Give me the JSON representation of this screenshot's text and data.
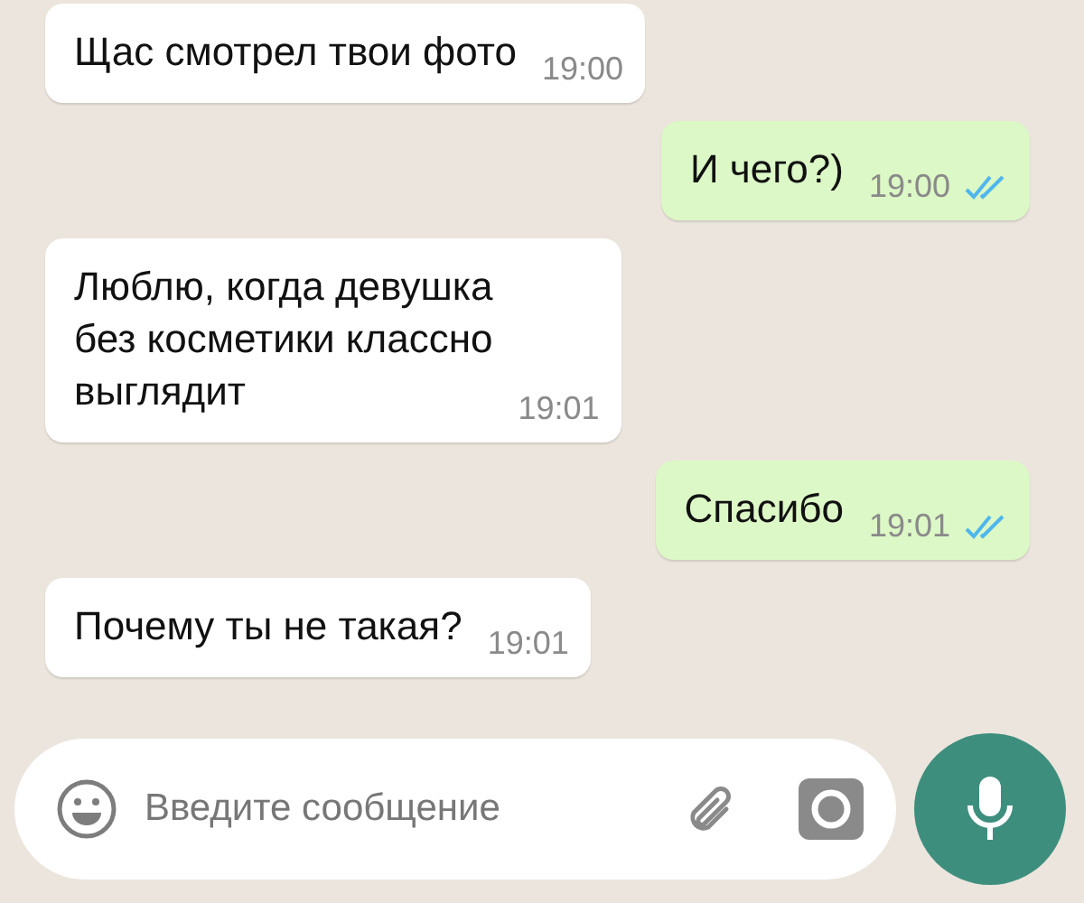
{
  "messages": [
    {
      "kind": "incoming",
      "text": "Щас смотрел твои фото",
      "time": "19:00"
    },
    {
      "kind": "outgoing",
      "text": "И чего?)",
      "time": "19:00",
      "read": true
    },
    {
      "kind": "incoming",
      "text": "Люблю, когда девушка\nбез косметики классно\nвыглядит",
      "time": "19:01"
    },
    {
      "kind": "outgoing",
      "text": "Спасибо",
      "time": "19:01",
      "read": true
    },
    {
      "kind": "incoming",
      "text": "Почему ты не такая?",
      "time": "19:01"
    }
  ],
  "composer": {
    "placeholder": "Введите сообщение"
  }
}
